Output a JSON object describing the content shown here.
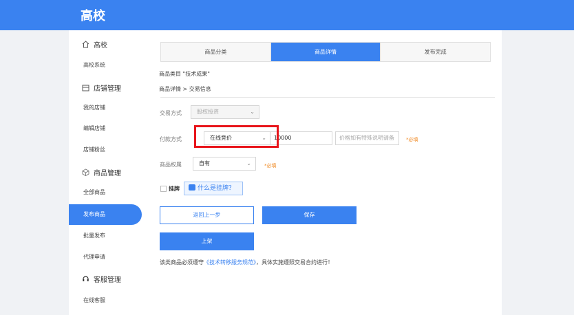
{
  "header": {
    "brand": "高校"
  },
  "sidebar": {
    "groups": [
      {
        "label": "高校",
        "items": [
          "高校系统"
        ]
      },
      {
        "label": "店铺管理",
        "items": [
          "我的店铺",
          "编辑店铺",
          "店铺粉丝"
        ]
      },
      {
        "label": "商品管理",
        "items": [
          "全部商品",
          "发布商品",
          "批量发布",
          "代理申请"
        ]
      },
      {
        "label": "客服管理",
        "items": [
          "在线客服"
        ]
      }
    ],
    "active_item": "发布商品"
  },
  "steps": [
    "商品分类",
    "商品详情",
    "发布完成"
  ],
  "active_step": "商品详情",
  "category_line": "商品类目  \"技术成果\"",
  "breadcrumb": "商品详情 > 交易信息",
  "form": {
    "trade_method": {
      "label": "交易方式",
      "value": "股权投资"
    },
    "payment": {
      "label": "付款方式",
      "value": "在线竞价",
      "amount": "10000",
      "note_placeholder": "价格如有特殊说明请备",
      "required": "*必填"
    },
    "ownership": {
      "label": "商品权属",
      "value": "自有",
      "required": "*必填"
    }
  },
  "guapai": {
    "label": "挂牌",
    "help": "什么是挂牌？"
  },
  "buttons": {
    "back": "返回上一步",
    "save": "保存",
    "list": "上架"
  },
  "notice": {
    "prefix": "该类商品必须遵守",
    "link": "《技术转移服务规范》",
    "suffix": "，具体实施遵照交易合约进行！"
  },
  "colors": {
    "accent": "#3a82f0",
    "highlight": "#e8141a",
    "required": "#f08a24"
  }
}
